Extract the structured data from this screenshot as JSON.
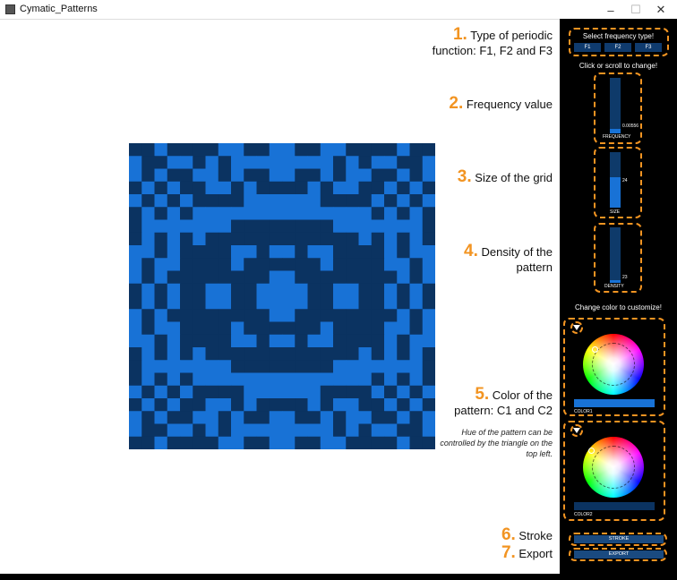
{
  "window": {
    "title": "Cymatic_Patterns",
    "minimize": "–",
    "maximize": "☐",
    "close": "✕"
  },
  "colors": {
    "c1": "#1872d6",
    "c2": "#0b3361",
    "accent": "#f29422",
    "panel": "#000000"
  },
  "grid": {
    "size": 24,
    "rows": [
      "001000011001100110000100",
      "100110101111111101011001",
      "101001101001100101100101",
      "010100110100001011001010",
      "101010000111111000010101",
      "010101111111111111101010",
      "011111110000000011111110",
      "010101000000000000101010",
      "110100001101101100001011",
      "101100001000000100001101",
      "101000000001100000000101",
      "010100110011110011001010",
      "010100110011110011001010",
      "101000000001100000000101",
      "101100001000000100001101",
      "110100001101101100001011",
      "010101000000000000101010",
      "011111110000000011111110",
      "010101111111111111101010",
      "101010000111111000010101",
      "010100110100001011001010",
      "101001101001100101100101",
      "100110101111111101011001",
      "001000011001100110000100"
    ]
  },
  "annotations": [
    {
      "num": "1.",
      "lines": [
        "Type of periodic",
        "function: F1, F2 and F3"
      ]
    },
    {
      "num": "2.",
      "lines": [
        "Frequency value"
      ]
    },
    {
      "num": "3.",
      "lines": [
        "Size of the grid"
      ]
    },
    {
      "num": "4.",
      "lines": [
        "Density of the",
        "pattern"
      ]
    },
    {
      "num": "5.",
      "lines": [
        "Color of the",
        "pattern: C1 and  C2"
      ]
    },
    {
      "num": "6.",
      "lines": [
        "Stroke"
      ]
    },
    {
      "num": "7.",
      "lines": [
        "Export"
      ]
    }
  ],
  "note": "Hue of the pattern can be controlled by the triangle on the top left.",
  "panel": {
    "select_label": "Select frequency type!",
    "freq_buttons": [
      "F1",
      "F2",
      "F3"
    ],
    "change_hint": "Click or scroll to change!",
    "frequency": {
      "label": "FREQUENCY",
      "value": "0.00556",
      "level": 0.08
    },
    "size": {
      "label": "SIZE",
      "value": "24",
      "level": 0.55
    },
    "density": {
      "label": "DENSITY",
      "value": "23",
      "level": 0.05
    },
    "color_hint": "Change color to customize!",
    "color1_label": "COLOR1",
    "color2_label": "COLOR2",
    "stroke_label": "STROKE",
    "export_label": "EXPORT"
  }
}
